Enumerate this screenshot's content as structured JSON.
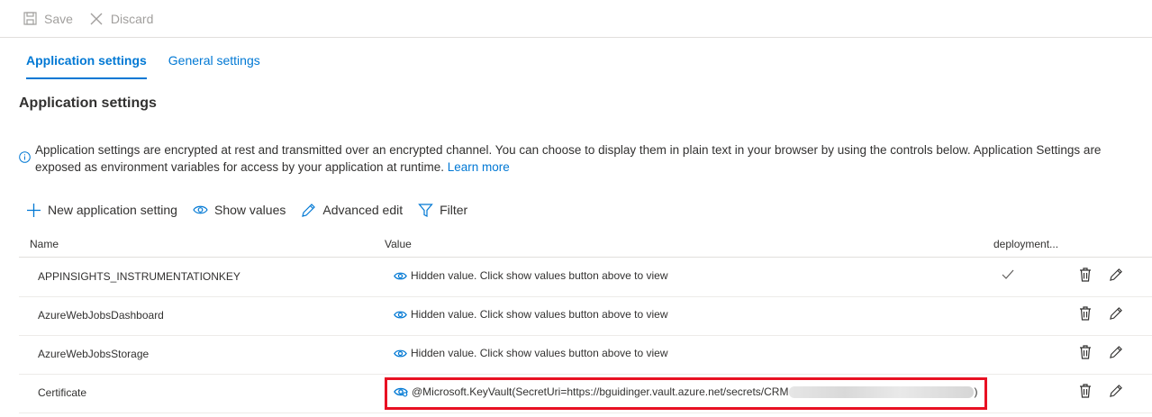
{
  "toolbar": {
    "save_label": "Save",
    "discard_label": "Discard"
  },
  "tabs": [
    {
      "label": "Application settings",
      "active": true
    },
    {
      "label": "General settings",
      "active": false
    }
  ],
  "section": {
    "title": "Application settings"
  },
  "info": {
    "text": "Application settings are encrypted at rest and transmitted over an encrypted channel. You can choose to display them in plain text in your browser by using the controls below. Application Settings are exposed as environment variables for access by your application at runtime.",
    "link": "Learn more"
  },
  "actions": {
    "new_label": "New application setting",
    "show_label": "Show values",
    "advanced_label": "Advanced edit",
    "filter_label": "Filter"
  },
  "grid": {
    "headers": {
      "name": "Name",
      "value": "Value",
      "deployment": "deployment..."
    },
    "rows": [
      {
        "name": "APPINSIGHTS_INSTRUMENTATIONKEY",
        "value": "Hidden value. Click show values button above to view",
        "slot": true
      },
      {
        "name": "AzureWebJobsDashboard",
        "value": "Hidden value. Click show values button above to view",
        "slot": false
      },
      {
        "name": "AzureWebJobsStorage",
        "value": "Hidden value. Click show values button above to view",
        "slot": false
      },
      {
        "name": "Certificate",
        "value": "@Microsoft.KeyVault(SecretUri=https://bguidinger.vault.azure.net/secrets/CRM",
        "value_suffix": ")",
        "slot": false
      }
    ]
  },
  "colors": {
    "accent": "#0078d4",
    "highlight": "#e81123",
    "disabled": "#a19f9d"
  },
  "icons": {
    "save": "save-icon",
    "discard": "close-icon",
    "info": "info-icon",
    "add": "plus-icon",
    "eye": "eye-icon",
    "edit": "pencil-icon",
    "filter": "filter-icon",
    "delete": "trash-icon",
    "check": "checkmark-icon",
    "keyvault": "keyvault-reference-icon"
  }
}
